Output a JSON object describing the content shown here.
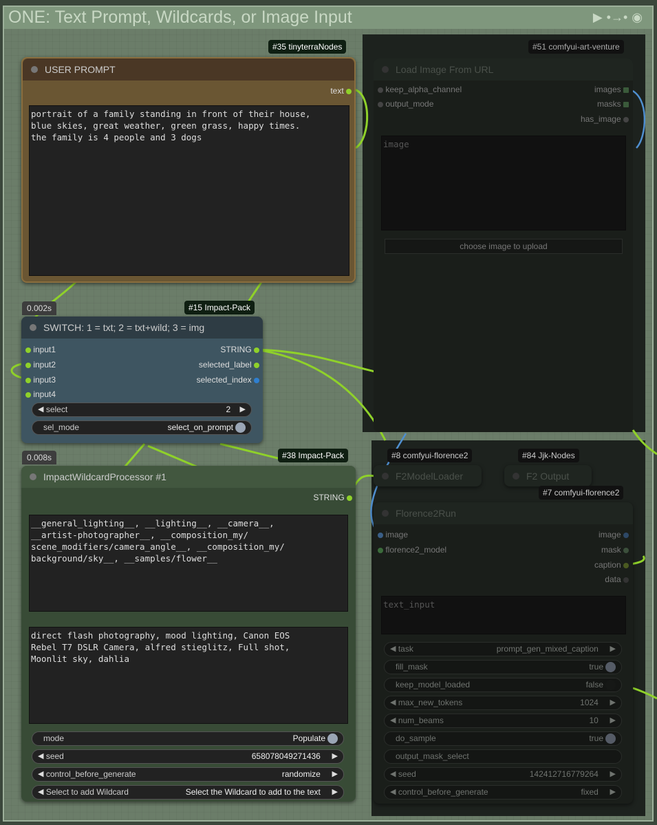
{
  "group": {
    "title": "ONE: Text Prompt, Wildcards, or Image Input",
    "icons": [
      "play-icon",
      "link-icon",
      "eye-icon"
    ]
  },
  "user_prompt": {
    "badge": "#35 tinyterraNodes",
    "title": "USER PROMPT",
    "output": "text",
    "text": "portrait of a family standing in front of their house,\nblue skies, great weather, green grass, happy times.\nthe family is 4 people and 3 dogs"
  },
  "switch": {
    "badge": "#15 Impact-Pack",
    "timing": "0.002s",
    "title": "SWITCH: 1 = txt; 2 = txt+wild; 3 = img",
    "inputs": [
      "input1",
      "input2",
      "input3",
      "input4"
    ],
    "outputs": [
      "STRING",
      "selected_label",
      "selected_index"
    ],
    "select_label": "select",
    "select_value": "2",
    "sel_mode_label": "sel_mode",
    "sel_mode_value": "select_on_prompt"
  },
  "wildcard": {
    "badge": "#38 Impact-Pack",
    "timing": "0.008s",
    "title": "ImpactWildcardProcessor #1",
    "output": "STRING",
    "template": "__general_lighting__, __lighting__, __camera__,\n__artist-photographer__, __composition_my/\nscene_modifiers/camera_angle__, __composition_my/\nbackground/sky__, __samples/flower__",
    "populated": "direct flash photography, mood lighting, Canon EOS\nRebel T7 DSLR Camera, alfred stieglitz, Full shot,\nMoonlit sky, dahlia",
    "widgets": [
      {
        "label": "mode",
        "value": "Populate",
        "kind": "toggle"
      },
      {
        "label": "seed",
        "value": "658078049271436",
        "kind": "number"
      },
      {
        "label": "control_before_generate",
        "value": "randomize",
        "kind": "combo"
      },
      {
        "label": "Select to add Wildcard",
        "value": "Select the Wildcard to add to the text",
        "kind": "combo"
      }
    ]
  },
  "load_image": {
    "badge": "#51 comfyui-art-venture",
    "title": "Load Image From URL",
    "inputs": [
      "keep_alpha_channel",
      "output_mode"
    ],
    "outputs": [
      "images",
      "masks",
      "has_image"
    ],
    "image_placeholder": "image",
    "upload_button": "choose image to upload"
  },
  "f2_loader": {
    "badge": "#8 comfyui-florence2",
    "title": "F2ModelLoader"
  },
  "f2_output": {
    "badge": "#84 Jjk-Nodes",
    "title": "F2 Output"
  },
  "florence_run": {
    "badge": "#7 comfyui-florence2",
    "title": "Florence2Run",
    "inputs": [
      "image",
      "florence2_model"
    ],
    "outputs": [
      "image",
      "mask",
      "caption",
      "data"
    ],
    "text_input_placeholder": "text_input",
    "widgets": [
      {
        "label": "task",
        "value": "prompt_gen_mixed_caption",
        "kind": "combo"
      },
      {
        "label": "fill_mask",
        "value": "true",
        "kind": "toggle"
      },
      {
        "label": "keep_model_loaded",
        "value": "false",
        "kind": "toggle-off"
      },
      {
        "label": "max_new_tokens",
        "value": "1024",
        "kind": "number"
      },
      {
        "label": "num_beams",
        "value": "10",
        "kind": "number"
      },
      {
        "label": "do_sample",
        "value": "true",
        "kind": "toggle"
      },
      {
        "label": "output_mask_select",
        "value": "",
        "kind": "text"
      },
      {
        "label": "seed",
        "value": "142412716779264",
        "kind": "number"
      },
      {
        "label": "control_before_generate",
        "value": "fixed",
        "kind": "combo"
      }
    ]
  },
  "colors": {
    "wire_string": "#8fd12a",
    "wire_image": "#4f8fd0",
    "user_prompt_title": "#4a3725",
    "user_prompt_body": "#6a5633",
    "switch_title": "#2e3c44",
    "switch_body": "#3e5561",
    "wildcard_title": "#42573f",
    "wildcard_body": "#384b36"
  }
}
